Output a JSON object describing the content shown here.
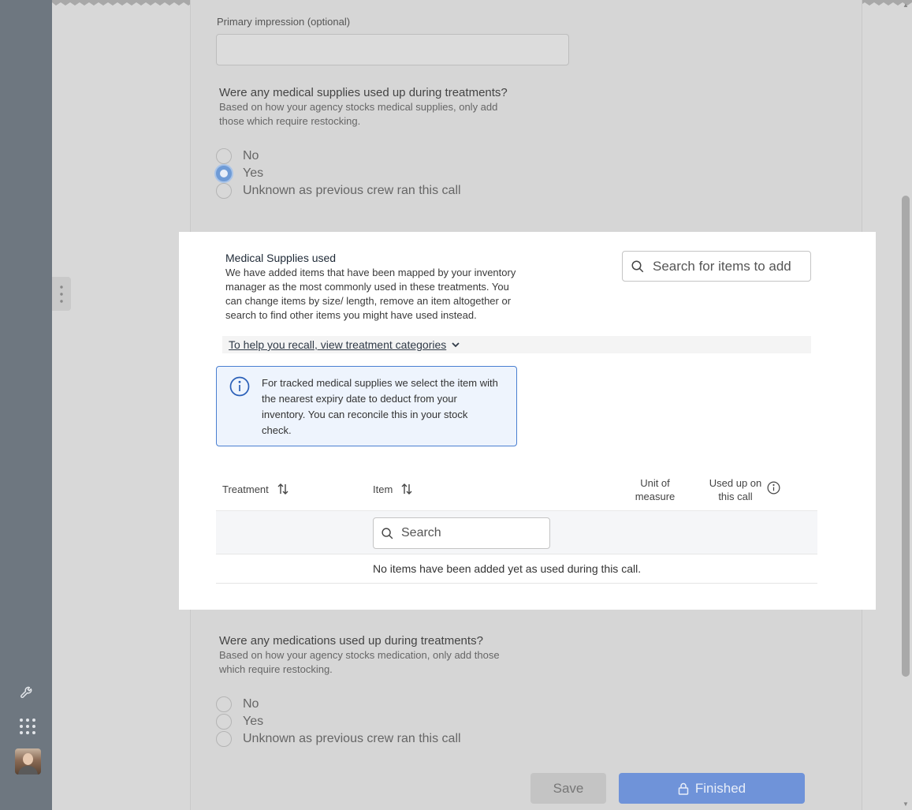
{
  "form": {
    "primary_impression_label": "Primary impression (optional)",
    "primary_impression_value": "",
    "supplies_question": {
      "title": "Were any medical supplies used up during treatments?",
      "subtitle": "Based on how your agency stocks medical supplies, only add those which require restocking.",
      "options": [
        "No",
        "Yes",
        "Unknown as previous crew ran this call"
      ],
      "selected": "Yes"
    },
    "medications_question": {
      "title": "Were any medications used up during treatments?",
      "subtitle": "Based on how your agency stocks medication, only add those which require restocking.",
      "options": [
        "No",
        "Yes",
        "Unknown as previous crew ran this call"
      ],
      "selected": ""
    }
  },
  "supplies_card": {
    "title": "Medical Supplies used",
    "description": "We have added items that have been mapped by your inventory manager as the most commonly used in these treatments. You can change items by size/ length, remove an item altogether or search to find other items you might have used instead.",
    "search_placeholder": "Search for items to add",
    "recall_link": "To help you recall, view treatment categories",
    "info_text": "For tracked medical supplies we select the item with the nearest expiry date to deduct from your inventory. You can reconcile this in your stock check.",
    "table": {
      "headers": {
        "treatment": "Treatment",
        "item": "Item",
        "unit_of_measure": "Unit of measure",
        "used_up": "Used up on this call"
      },
      "search_placeholder": "Search",
      "empty_message": "No items have been added yet as used during this call."
    }
  },
  "actions": {
    "save": "Save",
    "finished": "Finished"
  },
  "icons": {
    "rail": [
      "wrench-icon",
      "apps-grid-icon"
    ],
    "lock": "lock-icon"
  },
  "colors": {
    "rail_bg": "#6e7780",
    "primary_button": "#6f93d9",
    "info_border": "#4a7fd1",
    "info_bg": "#eef4fd",
    "radio_selected": "#6f9bd6"
  }
}
